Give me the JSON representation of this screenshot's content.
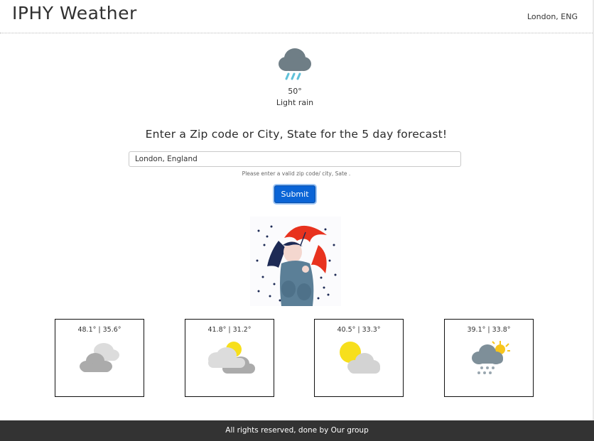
{
  "header": {
    "title": "IPHY Weather",
    "location": "London, ENG"
  },
  "current": {
    "temp": "50°",
    "description": "Light rain",
    "icon": "rain-cloud-icon"
  },
  "search": {
    "prompt": "Enter a Zip code or City, State for the 5 day forecast!",
    "value": "London, England",
    "hint": "Please enter a valid zip code/ city, Sate .",
    "submit_label": "Submit"
  },
  "illustration": {
    "icon": "girl-with-umbrella-illustration"
  },
  "forecast": [
    {
      "range": "48.1° | 35.6°",
      "icon": "cloudy-icon"
    },
    {
      "range": "41.8° | 31.2°",
      "icon": "partly-cloudy-icon"
    },
    {
      "range": "40.5° | 33.3°",
      "icon": "sun-behind-cloud-icon"
    },
    {
      "range": "39.1° | 33.8°",
      "icon": "snow-cloud-icon"
    }
  ],
  "footer": {
    "text": "All rights reserved, done by Our group"
  },
  "colors": {
    "primary_button": "#0a64d6",
    "footer_bg": "#333333"
  }
}
